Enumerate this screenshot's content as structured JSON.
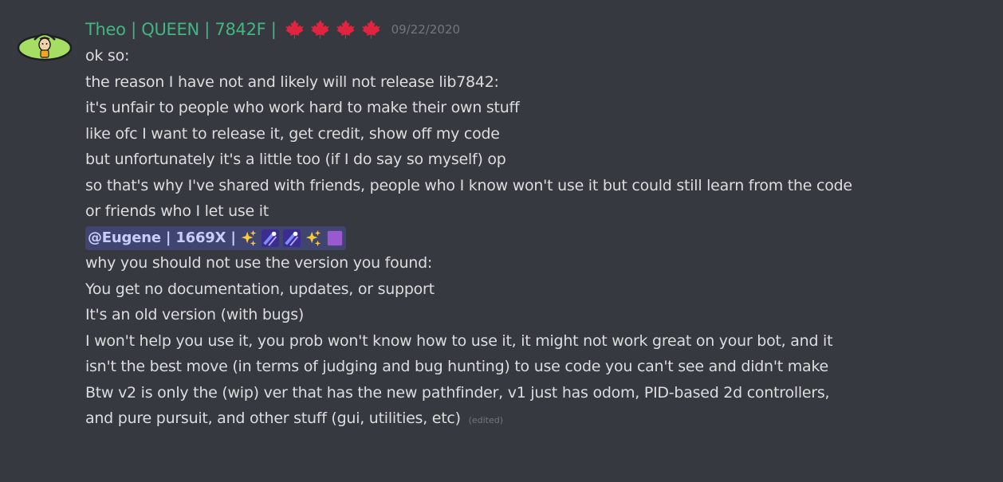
{
  "message": {
    "username": "Theo | QUEEN | 7842F |",
    "username_color": "#43b581",
    "name_emojis": [
      "maple-leaf",
      "maple-leaf",
      "maple-leaf",
      "maple-leaf"
    ],
    "timestamp": "09/22/2020",
    "avatar_icon": "green-avatar-icon",
    "lines": [
      "ok so:",
      "the reason I have not and likely will not release lib7842:",
      "it's unfair to people who work hard to make their own stuff",
      "like ofc I want to release it, get credit, show off my code",
      "but unfortunately it's a little too (if I do say so myself) op",
      "so that's why I've shared with friends, people who I know won't use it but could still learn from the code",
      "or friends who I let use it"
    ],
    "mention": {
      "text": "@Eugene | 1669X |",
      "emojis": [
        "sparkles",
        "shooting-star",
        "shooting-star",
        "sparkles",
        "purple-square"
      ]
    },
    "lines_after": [
      "why you should not use the version you found:",
      "You get no documentation, updates, or support",
      "It's an old version (with bugs)",
      "I won't help you use it, you prob won't know how to use it, it might not work great on your bot, and it",
      "isn't the best move (in terms of judging and bug hunting) to use code you can't see and didn't make",
      "Btw v2 is only the (wip) ver that has the new pathfinder, v1 just has odom, PID-based 2d controllers,",
      "and pure pursuit, and other stuff (gui, utilities, etc)"
    ],
    "edited_label": "(edited)"
  },
  "colors": {
    "background": "#36393f",
    "text": "#dcddde",
    "timestamp": "#72767d",
    "mention_bg": "#474d7a",
    "mention_text": "#c9cdfb",
    "leaf": "#e0233e"
  }
}
